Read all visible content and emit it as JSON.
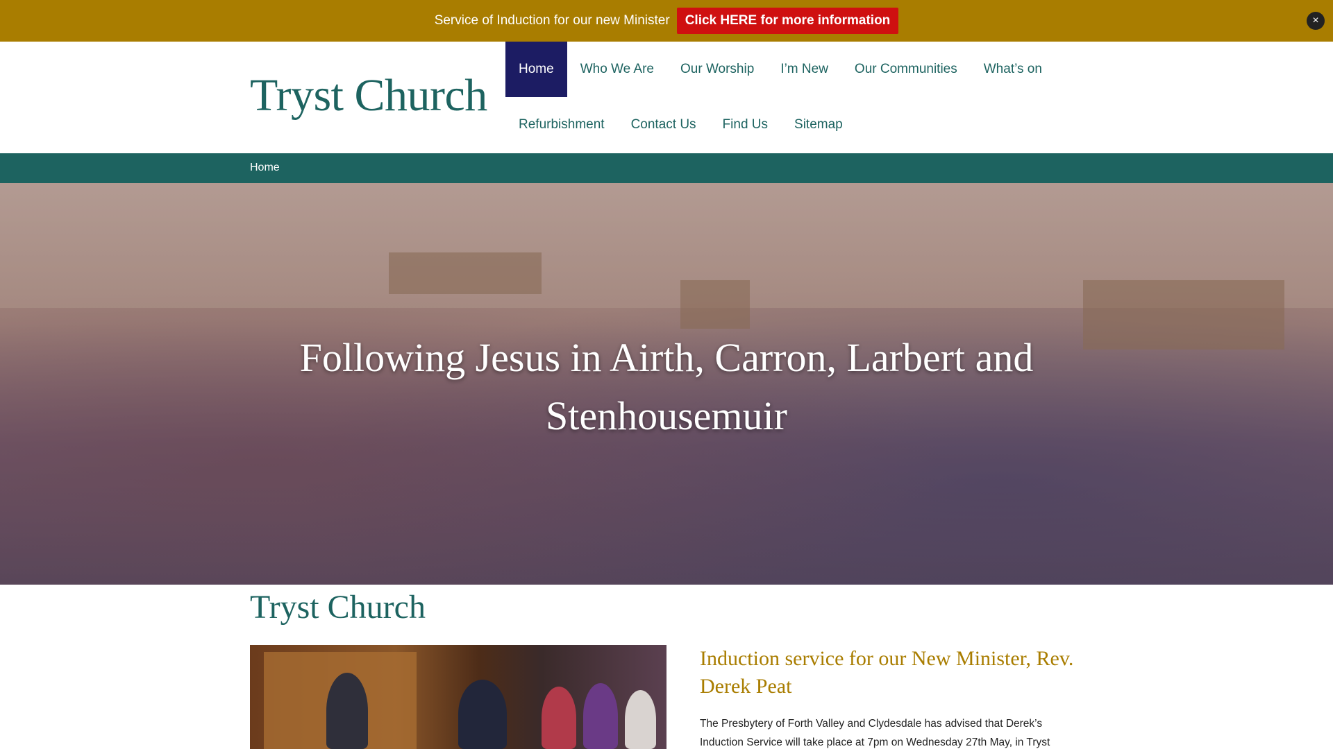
{
  "announcement": {
    "text": "Service of Induction for our new Minister",
    "button_label": "Click HERE for more information",
    "close_label": "×"
  },
  "site": {
    "title": "Tryst Church"
  },
  "nav": {
    "row1": [
      "Home",
      "Who We Are",
      "Our Worship",
      "I’m New",
      "Our Communities",
      "What’s on"
    ],
    "row2": [
      "Refurbishment",
      "Contact Us",
      "Find Us",
      "Sitemap"
    ],
    "active": "Home"
  },
  "breadcrumb": {
    "label": "Home"
  },
  "hero": {
    "heading": "Following Jesus in Airth, Carron, Larbert and Stenhousemuir"
  },
  "content": {
    "title": "Tryst Church",
    "news_title": "Induction service for our New Minister, Rev. Derek Peat",
    "news_body": "The Presbytery of Forth Valley and Clydesdale has advised that Derek’s Induction Service will take place at 7pm on Wednesday 27th May, in Tryst"
  },
  "colors": {
    "announcement_bg": "#a97d00",
    "button_red": "#cf1010",
    "brand_teal": "#1d6360",
    "nav_active": "#1c1c63",
    "news_gold": "#a97d00"
  }
}
